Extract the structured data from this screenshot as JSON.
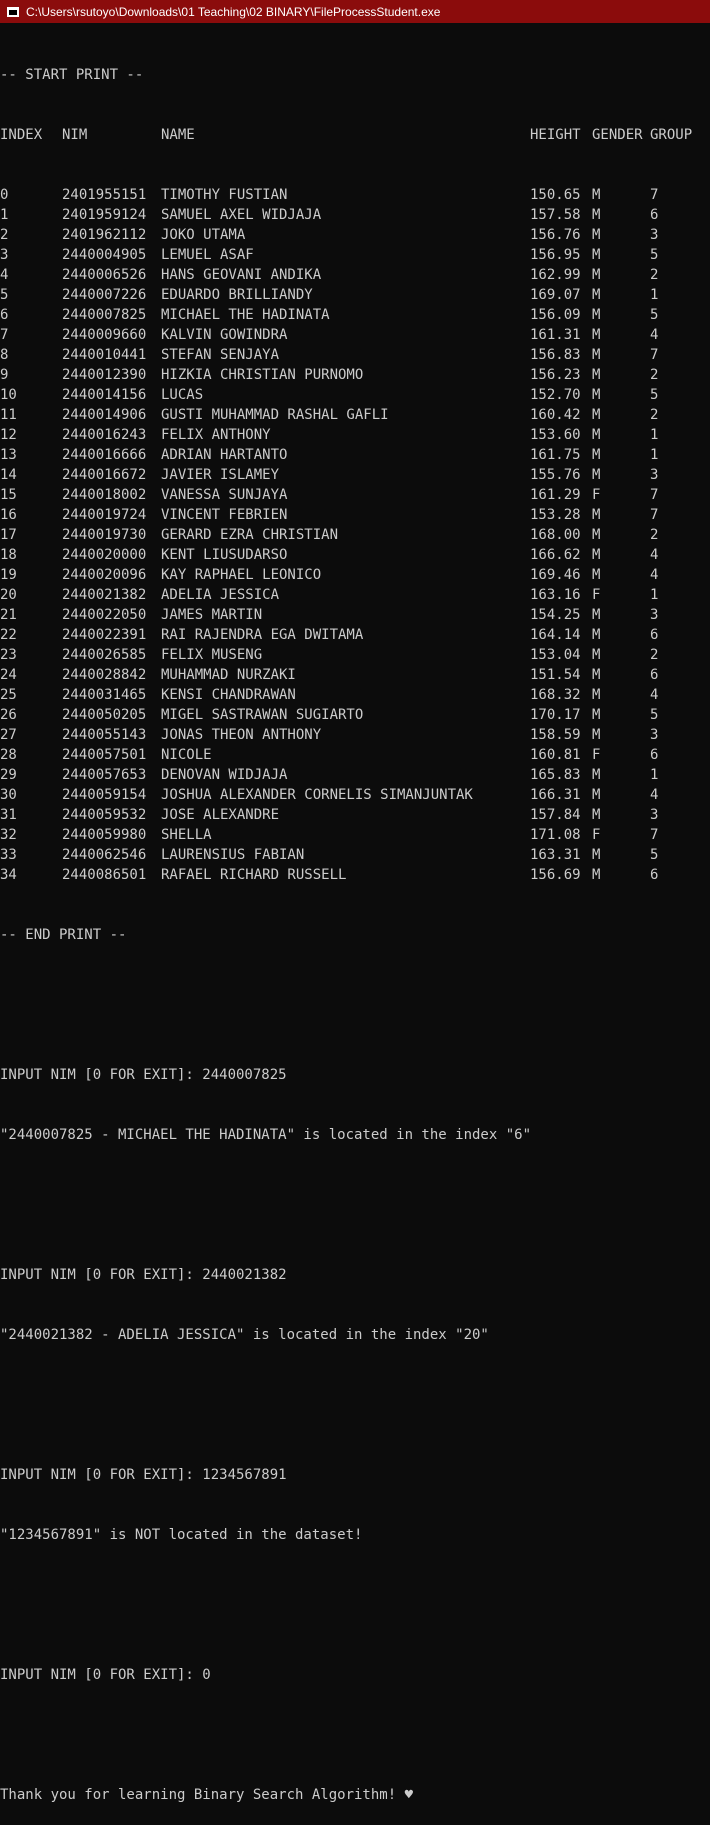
{
  "window": {
    "title": "C:\\Users\\rsutoyo\\Downloads\\01 Teaching\\02 BINARY\\FileProcessStudent.exe"
  },
  "console": {
    "start_print": "-- START PRINT --",
    "headers": {
      "index": "INDEX",
      "nim": "NIM",
      "name": "NAME",
      "height": "HEIGHT",
      "gender": "GENDER",
      "group": "GROUP"
    },
    "rows": [
      {
        "index": "0",
        "nim": "2401955151",
        "name": "TIMOTHY FUSTIAN",
        "height": "150.65",
        "gender": "M",
        "group": "7"
      },
      {
        "index": "1",
        "nim": "2401959124",
        "name": "SAMUEL AXEL WIDJAJA",
        "height": "157.58",
        "gender": "M",
        "group": "6"
      },
      {
        "index": "2",
        "nim": "2401962112",
        "name": "JOKO UTAMA",
        "height": "156.76",
        "gender": "M",
        "group": "3"
      },
      {
        "index": "3",
        "nim": "2440004905",
        "name": "LEMUEL ASAF",
        "height": "156.95",
        "gender": "M",
        "group": "5"
      },
      {
        "index": "4",
        "nim": "2440006526",
        "name": "HANS GEOVANI ANDIKA",
        "height": "162.99",
        "gender": "M",
        "group": "2"
      },
      {
        "index": "5",
        "nim": "2440007226",
        "name": "EDUARDO BRILLIANDY",
        "height": "169.07",
        "gender": "M",
        "group": "1"
      },
      {
        "index": "6",
        "nim": "2440007825",
        "name": "MICHAEL THE HADINATA",
        "height": "156.09",
        "gender": "M",
        "group": "5"
      },
      {
        "index": "7",
        "nim": "2440009660",
        "name": "KALVIN GOWINDRA",
        "height": "161.31",
        "gender": "M",
        "group": "4"
      },
      {
        "index": "8",
        "nim": "2440010441",
        "name": "STEFAN SENJAYA",
        "height": "156.83",
        "gender": "M",
        "group": "7"
      },
      {
        "index": "9",
        "nim": "2440012390",
        "name": "HIZKIA CHRISTIAN PURNOMO",
        "height": "156.23",
        "gender": "M",
        "group": "2"
      },
      {
        "index": "10",
        "nim": "2440014156",
        "name": "LUCAS",
        "height": "152.70",
        "gender": "M",
        "group": "5"
      },
      {
        "index": "11",
        "nim": "2440014906",
        "name": "GUSTI MUHAMMAD RASHAL GAFLI",
        "height": "160.42",
        "gender": "M",
        "group": "2"
      },
      {
        "index": "12",
        "nim": "2440016243",
        "name": "FELIX ANTHONY",
        "height": "153.60",
        "gender": "M",
        "group": "1"
      },
      {
        "index": "13",
        "nim": "2440016666",
        "name": "ADRIAN HARTANTO",
        "height": "161.75",
        "gender": "M",
        "group": "1"
      },
      {
        "index": "14",
        "nim": "2440016672",
        "name": "JAVIER ISLAMEY",
        "height": "155.76",
        "gender": "M",
        "group": "3"
      },
      {
        "index": "15",
        "nim": "2440018002",
        "name": "VANESSA SUNJAYA",
        "height": "161.29",
        "gender": "F",
        "group": "7"
      },
      {
        "index": "16",
        "nim": "2440019724",
        "name": "VINCENT FEBRIEN",
        "height": "153.28",
        "gender": "M",
        "group": "7"
      },
      {
        "index": "17",
        "nim": "2440019730",
        "name": "GERARD EZRA CHRISTIAN",
        "height": "168.00",
        "gender": "M",
        "group": "2"
      },
      {
        "index": "18",
        "nim": "2440020000",
        "name": "KENT LIUSUDARSO",
        "height": "166.62",
        "gender": "M",
        "group": "4"
      },
      {
        "index": "19",
        "nim": "2440020096",
        "name": "KAY RAPHAEL LEONICO",
        "height": "169.46",
        "gender": "M",
        "group": "4"
      },
      {
        "index": "20",
        "nim": "2440021382",
        "name": "ADELIA JESSICA",
        "height": "163.16",
        "gender": "F",
        "group": "1"
      },
      {
        "index": "21",
        "nim": "2440022050",
        "name": "JAMES MARTIN",
        "height": "154.25",
        "gender": "M",
        "group": "3"
      },
      {
        "index": "22",
        "nim": "2440022391",
        "name": "RAI RAJENDRA EGA DWITAMA",
        "height": "164.14",
        "gender": "M",
        "group": "6"
      },
      {
        "index": "23",
        "nim": "2440026585",
        "name": "FELIX MUSENG",
        "height": "153.04",
        "gender": "M",
        "group": "2"
      },
      {
        "index": "24",
        "nim": "2440028842",
        "name": "MUHAMMAD NURZAKI",
        "height": "151.54",
        "gender": "M",
        "group": "6"
      },
      {
        "index": "25",
        "nim": "2440031465",
        "name": "KENSI CHANDRAWAN",
        "height": "168.32",
        "gender": "M",
        "group": "4"
      },
      {
        "index": "26",
        "nim": "2440050205",
        "name": "MIGEL SASTRAWAN SUGIARTO",
        "height": "170.17",
        "gender": "M",
        "group": "5"
      },
      {
        "index": "27",
        "nim": "2440055143",
        "name": "JONAS THEON ANTHONY",
        "height": "158.59",
        "gender": "M",
        "group": "3"
      },
      {
        "index": "28",
        "nim": "2440057501",
        "name": "NICOLE",
        "height": "160.81",
        "gender": "F",
        "group": "6"
      },
      {
        "index": "29",
        "nim": "2440057653",
        "name": "DENOVAN WIDJAJA",
        "height": "165.83",
        "gender": "M",
        "group": "1"
      },
      {
        "index": "30",
        "nim": "2440059154",
        "name": "JOSHUA ALEXANDER CORNELIS SIMANJUNTAK",
        "height": "166.31",
        "gender": "M",
        "group": "4"
      },
      {
        "index": "31",
        "nim": "2440059532",
        "name": "JOSE ALEXANDRE",
        "height": "157.84",
        "gender": "M",
        "group": "3"
      },
      {
        "index": "32",
        "nim": "2440059980",
        "name": "SHELLA",
        "height": "171.08",
        "gender": "F",
        "group": "7"
      },
      {
        "index": "33",
        "nim": "2440062546",
        "name": "LAURENSIUS FABIAN",
        "height": "163.31",
        "gender": "M",
        "group": "5"
      },
      {
        "index": "34",
        "nim": "2440086501",
        "name": "RAFAEL RICHARD RUSSELL",
        "height": "156.69",
        "gender": "M",
        "group": "6"
      }
    ],
    "end_print": "-- END PRINT --",
    "queries": [
      {
        "prompt": "INPUT NIM [0 FOR EXIT]: 2440007825",
        "result": "\"2440007825 - MICHAEL THE HADINATA\" is located in the index \"6\""
      },
      {
        "prompt": "INPUT NIM [0 FOR EXIT]: 2440021382",
        "result": "\"2440021382 - ADELIA JESSICA\" is located in the index \"20\""
      },
      {
        "prompt": "INPUT NIM [0 FOR EXIT]: 1234567891",
        "result": "\"1234567891\" is NOT located in the dataset!"
      }
    ],
    "exit_prompt": "INPUT NIM [0 FOR EXIT]: 0",
    "farewell": "Thank you for learning Binary Search Algorithm! ♥"
  }
}
